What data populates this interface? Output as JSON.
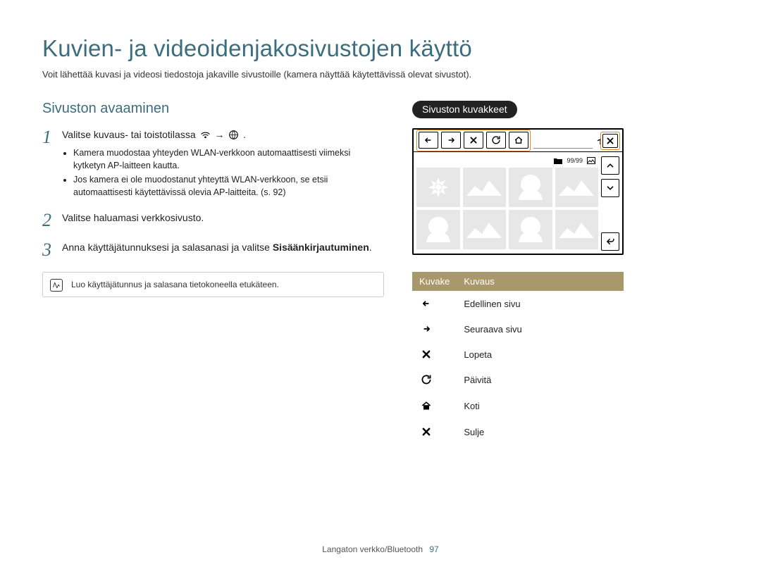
{
  "title": "Kuvien- ja videoidenjakosivustojen käyttö",
  "intro": "Voit lähettää kuvasi ja videosi tiedostoja jakaville sivustoille (kamera näyttää käytettävissä olevat sivustot).",
  "left": {
    "heading": "Sivuston avaaminen",
    "steps": [
      {
        "num": "1",
        "text_before": "Valitse kuvaus- tai toistotilassa ",
        "arrow": "→",
        "period": ".",
        "bullets": [
          "Kamera muodostaa yhteyden WLAN-verkkoon automaattisesti viimeksi kytketyn AP-laitteen kautta.",
          "Jos kamera ei ole muodostanut yhteyttä WLAN-verkkoon, se etsii automaattisesti käytettävissä olevia AP-laitteita. (s. 92)"
        ]
      },
      {
        "num": "2",
        "text": "Valitse haluamasi verkkosivusto."
      },
      {
        "num": "3",
        "text": "Anna käyttäjätunnuksesi ja salasanasi ja valitse ",
        "bold": "Sisäänkirjautuminen",
        "period": "."
      }
    ],
    "note": "Luo käyttäjätunnus ja salasana tietokoneella etukäteen."
  },
  "right": {
    "heading": "Sivuston kuvakkeet",
    "screen": {
      "counter": "99/99"
    },
    "table": {
      "headers": [
        "Kuvake",
        "Kuvaus"
      ],
      "rows": [
        {
          "icon": "arrow-left",
          "label": "Edellinen sivu"
        },
        {
          "icon": "arrow-right",
          "label": "Seuraava sivu"
        },
        {
          "icon": "x-bold",
          "label": "Lopeta"
        },
        {
          "icon": "refresh",
          "label": "Päivitä"
        },
        {
          "icon": "home",
          "label": "Koti"
        },
        {
          "icon": "x-bold",
          "label": "Sulje"
        }
      ]
    }
  },
  "footer": {
    "section": "Langaton verkko/Bluetooth",
    "page": "97"
  }
}
